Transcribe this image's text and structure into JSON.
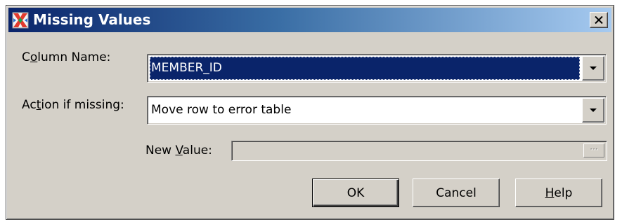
{
  "dialog": {
    "title": "Missing Values",
    "close_label": "×"
  },
  "fields": {
    "column_name": {
      "label_pre": "C",
      "label_mnemonic": "o",
      "label_post": "lumn Name:",
      "value": "MEMBER_ID"
    },
    "action_if_missing": {
      "label_pre": "Ac",
      "label_mnemonic": "t",
      "label_post": "ion if missing:",
      "value": "Move row to error table"
    },
    "new_value": {
      "label_pre": "New ",
      "label_mnemonic": "V",
      "label_post": "alue:",
      "value": "",
      "ellipsis": "···"
    }
  },
  "buttons": {
    "ok": "OK",
    "cancel": "Cancel",
    "help_mnemonic": "H",
    "help_rest": "elp"
  },
  "colors": {
    "selection": "#0a246a",
    "dialog_bg": "#d4d0c8"
  }
}
